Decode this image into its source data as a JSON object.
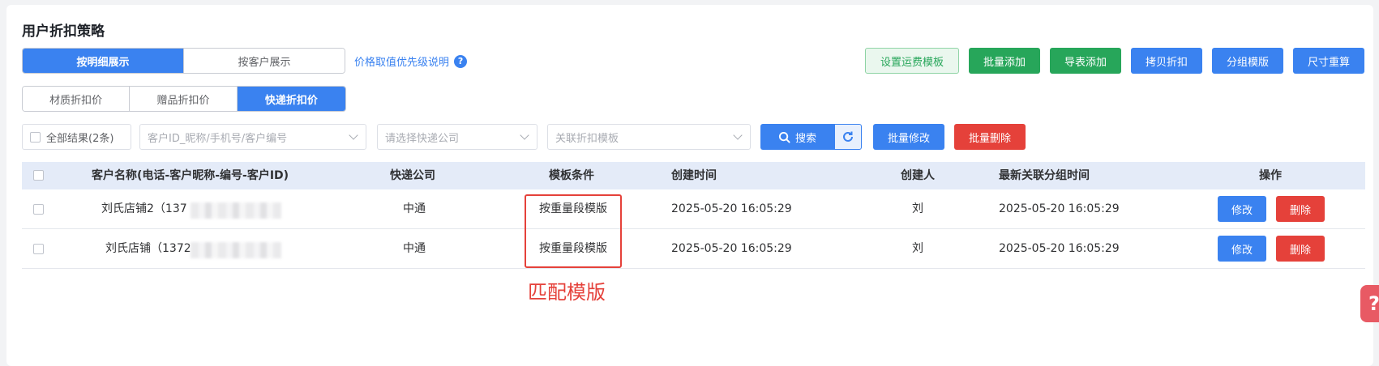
{
  "page": {
    "title": "用户折扣策略"
  },
  "view_tabs": [
    {
      "label": "按明细展示",
      "active": true
    },
    {
      "label": "按客户展示",
      "active": false
    }
  ],
  "price_priority_link": "价格取值优先级说明",
  "toolbar": {
    "shipping_template": "设置运费模板",
    "batch_add": "批量添加",
    "import_add": "导表添加",
    "copy_discount": "拷贝折扣",
    "group_template": "分组模版",
    "resize_recalc": "尺寸重算"
  },
  "category_tabs": [
    {
      "label": "材质折扣价",
      "active": false
    },
    {
      "label": "赠品折扣价",
      "active": false
    },
    {
      "label": "快递折扣价",
      "active": true
    }
  ],
  "filters": {
    "all_results": "全部结果(2条)",
    "customer_placeholder": "客户ID_昵称/手机号/客户编号",
    "express_placeholder": "请选择快递公司",
    "template_placeholder": "关联折扣模板",
    "search_label": "搜索",
    "batch_edit": "批量修改",
    "batch_delete": "批量删除"
  },
  "table": {
    "columns": [
      "客户名称(电话-客户昵称-编号-客户ID)",
      "快递公司",
      "模板条件",
      "创建时间",
      "创建人",
      "最新关联分组时间",
      "操作"
    ],
    "rows": [
      {
        "customer": "刘氏店铺2（137",
        "express": "中通",
        "condition": "按重量段模版",
        "created": "2025-05-20 16:05:29",
        "creator": "刘",
        "group_time": "2025-05-20 16:05:29",
        "edit": "修改",
        "delete": "删除"
      },
      {
        "customer": "刘氏店铺（1372",
        "express": "中通",
        "condition": "按重量段模版",
        "created": "2025-05-20 16:05:29",
        "creator": "刘",
        "group_time": "2025-05-20 16:05:29",
        "edit": "修改",
        "delete": "删除"
      }
    ]
  },
  "annotation": "匹配模版",
  "help_tab": "?",
  "colors": {
    "primary": "#3a82f0",
    "success": "#27a65a",
    "danger": "#e5413a",
    "header_bg": "#e4ebf8"
  }
}
